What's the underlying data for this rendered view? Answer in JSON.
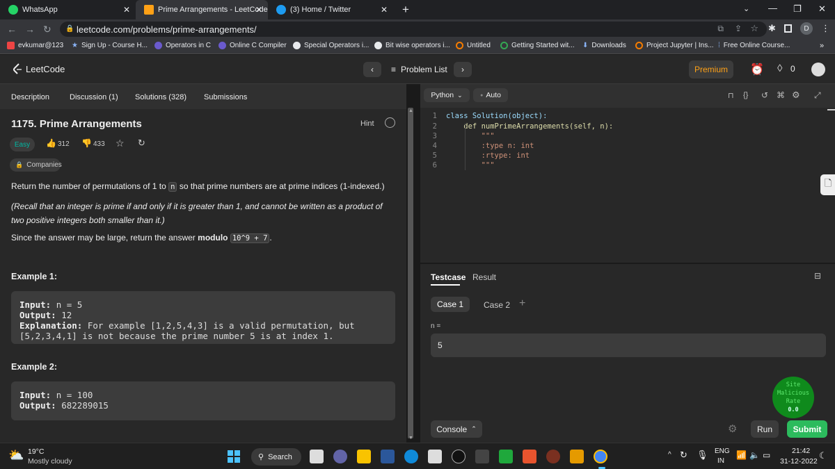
{
  "browser": {
    "tabs": [
      {
        "title": "WhatsApp",
        "icon": "whatsapp-icon"
      },
      {
        "title": "Prime Arrangements - LeetCode",
        "icon": "leetcode-icon"
      },
      {
        "title": "(3) Home / Twitter",
        "icon": "twitter-icon"
      }
    ],
    "url": "leetcode.com/problems/prime-arrangements/",
    "profile_initial": "D",
    "bookmarks": [
      "evkumar@123",
      "Sign Up - Course H...",
      "Operators in C",
      "Online C Compiler",
      "Special Operators i...",
      "Bit wise operators i...",
      "Untitled",
      "Getting Started wit...",
      "Downloads",
      "Project Jupyter | Ins...",
      "Free Online Course..."
    ]
  },
  "lcnav": {
    "brand": "LeetCode",
    "problem_list": "Problem List",
    "premium": "Premium",
    "coins": "0"
  },
  "left": {
    "tabs": [
      "Description",
      "Discussion (1)",
      "Solutions (328)",
      "Submissions"
    ],
    "title": "1175. Prime Arrangements",
    "hint": "Hint",
    "difficulty": "Easy",
    "likes": "312",
    "dislikes": "433",
    "companies": "Companies",
    "desc1_pre": "Return the number of permutations of 1 to",
    "desc1_code": "n",
    "desc1_post": "so that prime numbers are at prime indices (1-indexed.)",
    "desc2": "(Recall that an integer is prime if and only if it is greater than 1, and cannot be written as a product of two positive integers both smaller than it.)",
    "desc3_pre": "Since the answer may be large, return the answer",
    "desc3_bold": "modulo",
    "desc3_code": "10^9 + 7",
    "desc3_post": ".",
    "example1_title": "Example 1:",
    "example1": {
      "input_label": "Input:",
      "input": "n = 5",
      "output_label": "Output:",
      "output": "12",
      "expl_label": "Explanation:",
      "expl": "For example [1,2,5,4,3] is a valid permutation, but [5,2,3,4,1] is not because the prime number 5 is at index 1."
    },
    "example2_title": "Example 2:",
    "example2": {
      "input_label": "Input:",
      "input": "n = 100",
      "output_label": "Output:",
      "output": "682289015"
    }
  },
  "editor": {
    "language": "Python",
    "mode": "Auto",
    "lines": [
      {
        "n": "1",
        "text": "class Solution(object):"
      },
      {
        "n": "2",
        "text": "    def numPrimeArrangements(self, n):"
      },
      {
        "n": "3",
        "text": "        \"\"\""
      },
      {
        "n": "4",
        "text": "        :type n: int"
      },
      {
        "n": "5",
        "text": "        :rtype: int"
      },
      {
        "n": "6",
        "text": "        \"\"\""
      }
    ]
  },
  "test": {
    "tabs": [
      "Testcase",
      "Result"
    ],
    "case1": "Case 1",
    "case2": "Case 2",
    "var_label": "n =",
    "value": "5",
    "console": "Console",
    "run": "Run",
    "submit": "Submit",
    "badge_lines": [
      "Site",
      "Malicious",
      "Rate",
      "0.0"
    ]
  },
  "taskbar": {
    "temp": "19°C",
    "weather": "Mostly cloudy",
    "search": "Search",
    "lang1": "ENG",
    "lang2": "IN",
    "time": "21:42",
    "date": "31-12-2022"
  },
  "colors": {
    "accent_green": "#2cbb5d",
    "premium": "#ffa116",
    "easy": "#00b8a3",
    "badge": "#0f8a1c"
  }
}
